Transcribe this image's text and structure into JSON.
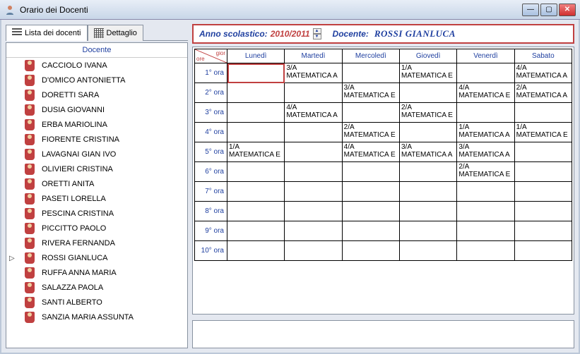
{
  "window": {
    "title": "Orario dei Docenti"
  },
  "tabs": {
    "list": "Lista dei docenti",
    "detail": "Dettaglio"
  },
  "teacher_list": {
    "header": "Docente",
    "items": [
      "CACCIOLO IVANA",
      "D'OMICO ANTONIETTA",
      "DORETTI SARA",
      "DUSIA GIOVANNI",
      "ERBA MARIOLINA",
      "FIORENTE CRISTINA",
      "LAVAGNAI GIAN IVO",
      "OLIVIERI CRISTINA",
      "ORETTI ANITA",
      "PASETI LORELLA",
      "PESCINA CRISTINA",
      "PICCITTO PAOLO",
      "RIVERA FERNANDA",
      "ROSSI GIANLUCA",
      "RUFFA ANNA MARIA",
      "SALAZZA PAOLA",
      "SANTI ALBERTO",
      "SANZIA MARIA ASSUNTA"
    ],
    "selected_index": 13
  },
  "info": {
    "year_label": "Anno scolastico:",
    "year_value": "2010/2011",
    "teacher_label": "Docente:",
    "teacher_value": "ROSSI GIANLUCA"
  },
  "timetable": {
    "corner": {
      "ore": "ore",
      "gior": "gior"
    },
    "days": [
      "Lunedì",
      "Martedì",
      "Mercoledì",
      "Giovedì",
      "Venerdì",
      "Sabato"
    ],
    "rows": [
      "1° ora",
      "2° ora",
      "3° ora",
      "4° ora",
      "5° ora",
      "6° ora",
      "7° ora",
      "8° ora",
      "9° ora",
      "10° ora"
    ],
    "cells": {
      "r0": [
        null,
        {
          "cls": "3/A",
          "subj": "MATEMATICA A"
        },
        null,
        {
          "cls": "1/A",
          "subj": "MATEMATICA E"
        },
        null,
        {
          "cls": "4/A",
          "subj": "MATEMATICA A"
        }
      ],
      "r1": [
        null,
        null,
        {
          "cls": "3/A",
          "subj": "MATEMATICA E"
        },
        null,
        {
          "cls": "4/A",
          "subj": "MATEMATICA E"
        },
        {
          "cls": "2/A",
          "subj": "MATEMATICA A"
        }
      ],
      "r2": [
        null,
        {
          "cls": "4/A",
          "subj": "MATEMATICA A"
        },
        null,
        {
          "cls": "2/A",
          "subj": "MATEMATICA E"
        },
        null,
        null
      ],
      "r3": [
        null,
        null,
        {
          "cls": "2/A",
          "subj": "MATEMATICA E"
        },
        null,
        {
          "cls": "1/A",
          "subj": "MATEMATICA A"
        },
        {
          "cls": "1/A",
          "subj": "MATEMATICA E"
        }
      ],
      "r4": [
        {
          "cls": "1/A",
          "subj": "MATEMATICA E"
        },
        null,
        {
          "cls": "4/A",
          "subj": "MATEMATICA E"
        },
        {
          "cls": "3/A",
          "subj": "MATEMATICA A"
        },
        {
          "cls": "3/A",
          "subj": "MATEMATICA A"
        },
        null
      ],
      "r5": [
        null,
        null,
        null,
        null,
        {
          "cls": "2/A",
          "subj": "MATEMATICA E"
        },
        null
      ],
      "r6": [
        null,
        null,
        null,
        null,
        null,
        null
      ],
      "r7": [
        null,
        null,
        null,
        null,
        null,
        null
      ],
      "r8": [
        null,
        null,
        null,
        null,
        null,
        null
      ],
      "r9": [
        null,
        null,
        null,
        null,
        null,
        null
      ]
    },
    "highlight": {
      "row": 0,
      "col": 0
    }
  }
}
